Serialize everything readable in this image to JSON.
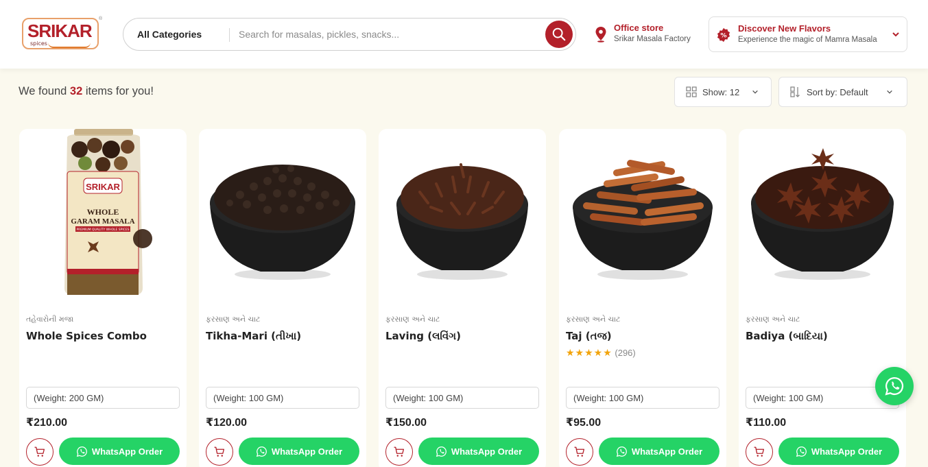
{
  "header": {
    "logo": {
      "brand": "SRIKAR",
      "sub": "spices",
      "reg": "®"
    },
    "search": {
      "category": "All Categories",
      "placeholder": "Search for masalas, pickles, snacks..."
    },
    "store": {
      "title": "Office store",
      "subtitle": "Srikar Masala Factory"
    },
    "promo": {
      "title": "Discover New Flavors",
      "subtitle": "Experience the magic of Mamra Masala"
    }
  },
  "results": {
    "prefix": "We found ",
    "count": "32",
    "suffix": " items for you!"
  },
  "controls": {
    "show_label": "Show:",
    "show_value": "12",
    "sort_label": "Sort by:",
    "sort_value": "Default"
  },
  "products": [
    {
      "category": "તહેવારોની મજા",
      "name": "Whole Spices Combo",
      "weight": "(Weight: 200 GM)",
      "price": "₹210.00",
      "whatsapp": "WhatsApp Order",
      "image": "whole-garam-masala-jar"
    },
    {
      "category": "ફરસાણ અને ચાટ",
      "name": "Tikha-Mari (તીખા)",
      "weight": "(Weight: 100 GM)",
      "price": "₹120.00",
      "whatsapp": "WhatsApp Order",
      "image": "black-pepper-bowl"
    },
    {
      "category": "ફરસાણ અને ચાટ",
      "name": "Laving (લવિંગ)",
      "weight": "(Weight: 100 GM)",
      "price": "₹150.00",
      "whatsapp": "WhatsApp Order",
      "image": "cloves-bowl"
    },
    {
      "category": "ફરસાણ અને ચાટ",
      "name": "Taj (તજ)",
      "rating_stars": "★★★★★",
      "rating_count": "(296)",
      "rating_value": 5,
      "weight": "(Weight: 100 GM)",
      "price": "₹95.00",
      "whatsapp": "WhatsApp Order",
      "image": "cinnamon-bowl"
    },
    {
      "category": "ફરસાણ અને ચાટ",
      "name": "Badiya (બાદિયા)",
      "weight": "(Weight: 100 GM)",
      "price": "₹110.00",
      "whatsapp": "WhatsApp Order",
      "image": "star-anise-bowl"
    }
  ],
  "jar_label": {
    "brand": "SRIKAR",
    "line1": "WHOLE",
    "line2": "GARAM MASALA",
    "ribbon": "PREMIUM QUALITY WHOLE SPICES"
  },
  "colors": {
    "brand_red": "#b3202a",
    "whatsapp_green": "#25d366",
    "page_bg": "#fbf9ee",
    "star": "#f2a40c"
  },
  "icons": [
    "search-icon",
    "location-pin-icon",
    "discount-badge-icon",
    "chevron-down-icon",
    "grid-icon",
    "sort-icon",
    "cart-icon",
    "whatsapp-icon"
  ]
}
